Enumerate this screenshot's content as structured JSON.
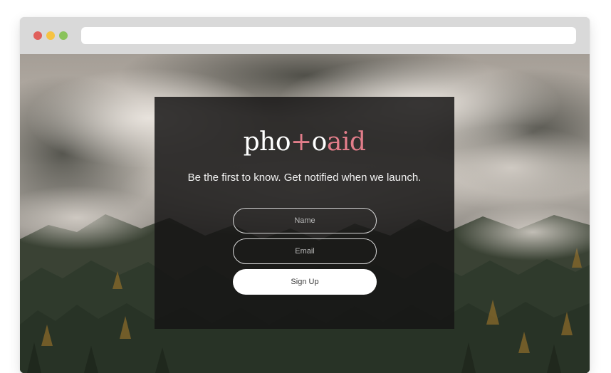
{
  "window": {
    "traffic_lights": [
      {
        "name": "close",
        "color": "#e0605b"
      },
      {
        "name": "minimize",
        "color": "#f6c343"
      },
      {
        "name": "maximize",
        "color": "#8ac35b"
      }
    ],
    "address_bar_value": ""
  },
  "page": {
    "background_scene": "misty-pine-forest",
    "logo": {
      "part1": "pho",
      "part2": "+",
      "part3": "o",
      "part4": "aid",
      "accent_color": "#e27d8a"
    },
    "tagline": "Be the first to know. Get notified when we launch.",
    "form": {
      "name_placeholder": "Name",
      "name_value": "",
      "email_placeholder": "Email",
      "email_value": "",
      "submit_label": "Sign Up"
    }
  }
}
